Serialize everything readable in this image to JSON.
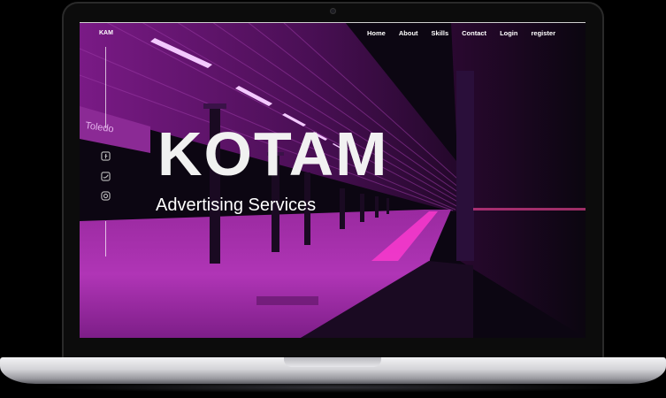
{
  "site": {
    "logo": "KAM",
    "nav": [
      "Home",
      "About",
      "Skills",
      "Contact",
      "Login",
      "register"
    ],
    "hero_title": "KOTAM",
    "hero_subtitle": "Advertising Services",
    "station_sign": "Toledo"
  },
  "social": [
    {
      "icon": "facebook-icon"
    },
    {
      "icon": "twitter-icon"
    },
    {
      "icon": "instagram-icon"
    }
  ],
  "colors": {
    "accent": "#c21fd0",
    "platform": "#d44ad0",
    "text": "#ffffff"
  }
}
